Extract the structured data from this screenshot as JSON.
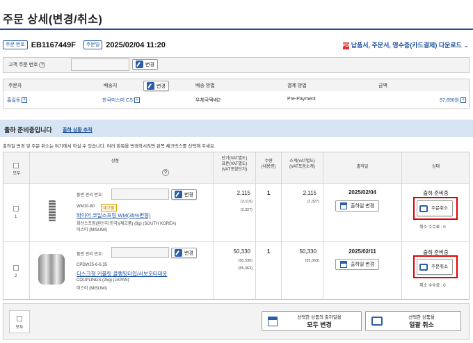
{
  "page": {
    "title": "주문 상세(변경/취소)"
  },
  "order": {
    "no_tag": "주문 번호",
    "no": "EB1167449F",
    "date_tag": "주문일",
    "date": "2025/02/04 11:20",
    "download": "납품서, 주문서, 영수증(카드결제) 다운로드"
  },
  "customer": {
    "label": "고객 주문 번호",
    "help": "?",
    "edit": "변경"
  },
  "info": {
    "orderer_h": "주문자",
    "orderer_v": "홍길동",
    "ship_h": "배송지",
    "ship_edit": "변경",
    "ship_v": "한국미스미 CS",
    "method_h": "배송 방법",
    "method_v": "우체국택배2",
    "pay_h": "결제 방법",
    "pay_v": "Pre-Payment",
    "amount_h": "금액",
    "amount_v": "57,690원"
  },
  "status": {
    "text": "출하 준비중입니다",
    "track": "출하 상황 추적"
  },
  "notice": "출하일 변경 및 주문 취소는 여기에서 하실 수 있습니다. 여러 항목을 변경하시려면 왼쪽 체크박스를 선택해 주세요.",
  "table": {
    "all": "모두",
    "product": "상품",
    "help": "?",
    "unit_l1": "단가(VAT별도)",
    "unit_l2": "표준(VAT별도)",
    "unit_l3": "(VAT포함단가)",
    "qty_l1": "수량",
    "qty_l2": "(내용량)",
    "sub_l1": "소계(VAT별도)",
    "sub_l2": "(VAT포함소계)",
    "ship": "출하일",
    "state": "상태"
  },
  "rows": [
    {
      "no": "1",
      "mgmt": "품번 관리 번호:",
      "edit": "변경",
      "code": "WM10-80",
      "stock": "재고품",
      "name": "와이어 코일스프링 WM(35%변형)",
      "maker": "화선스프링(원산지:한국)(재고품) (8g) (SOUTH KOREA)",
      "brand": "미스미 (MISUMI)",
      "price": "2,115",
      "price_std": "(2,115)",
      "price_vat": "(2,327)",
      "qty": "1",
      "sub": "2,115",
      "sub_vat": "(2,327)",
      "date": "2025/02/04",
      "date_btn": "출하일 변경",
      "state": "출하 준비중",
      "cancel": "주문취소",
      "fee": "취소 수수료 : 0"
    },
    {
      "no": "2",
      "mgmt": "품번 관리 번호:",
      "edit": "변경",
      "code": "CPDW25-6-6.35",
      "name": "디스크형 커플링 클램핑타입/서보모터대응",
      "maker": "COUPLINGS (25g) (JAPAN)",
      "brand": "미스미 (MISUMI)",
      "price": "50,330",
      "price_std": "(50,330)",
      "price_vat": "(55,363)",
      "qty": "1",
      "sub": "50,330",
      "sub_vat": "(55,363)",
      "date": "2025/02/11",
      "date_btn": "출하일 변경",
      "state": "출하 준비중",
      "cancel": "주문취소",
      "fee": "취소 수수료 : 0"
    }
  ],
  "footer": {
    "all": "모두",
    "change_l1": "선택한 상품의 출하일을",
    "change_l2": "모두 변경",
    "cancel_l1": "선택한 상품을",
    "cancel_l2": "일괄 취소"
  }
}
